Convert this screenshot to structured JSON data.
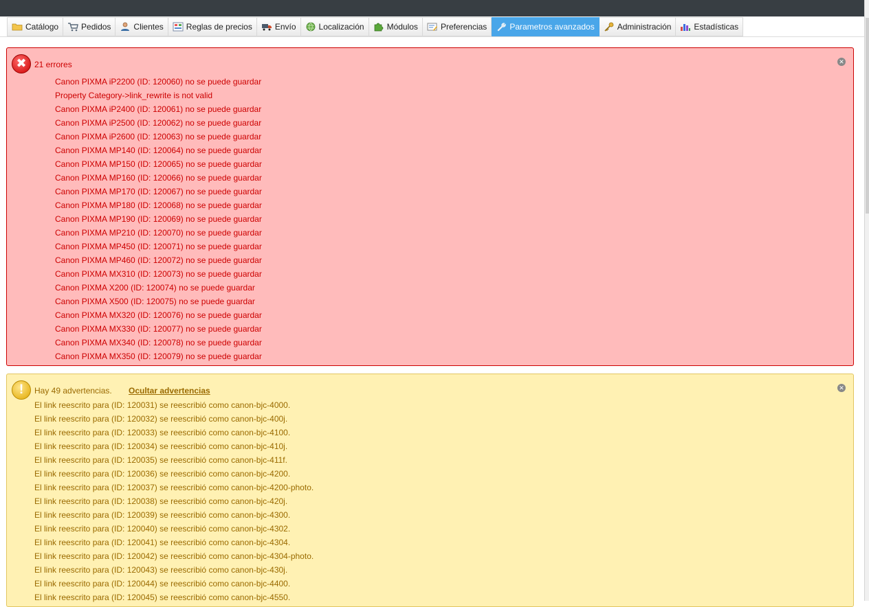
{
  "tabs": [
    {
      "label": "Catálogo",
      "icon": "folder-icon"
    },
    {
      "label": "Pedidos",
      "icon": "cart-icon"
    },
    {
      "label": "Clientes",
      "icon": "user-icon"
    },
    {
      "label": "Reglas de precios",
      "icon": "price-rules-icon"
    },
    {
      "label": "Envío",
      "icon": "truck-icon"
    },
    {
      "label": "Localización",
      "icon": "globe-icon"
    },
    {
      "label": "Módulos",
      "icon": "puzzle-icon"
    },
    {
      "label": "Preferencias",
      "icon": "preferences-icon"
    },
    {
      "label": "Parametros avanzados",
      "icon": "wrench-icon",
      "active": true
    },
    {
      "label": "Administración",
      "icon": "key-icon"
    },
    {
      "label": "Estadísticas",
      "icon": "bar-chart-icon"
    }
  ],
  "errors": {
    "title": "21 errores",
    "items": [
      "Canon PIXMA iP2200  (ID: 120060) no se puede guardar",
      "Property Category->link_rewrite is not valid",
      "Canon PIXMA iP2400 (ID: 120061) no se puede guardar",
      "Canon PIXMA iP2500 (ID: 120062) no se puede guardar",
      "Canon PIXMA iP2600 (ID: 120063) no se puede guardar",
      "Canon PIXMA MP140 (ID: 120064) no se puede guardar",
      "Canon PIXMA MP150 (ID: 120065) no se puede guardar",
      "Canon PIXMA MP160 (ID: 120066) no se puede guardar",
      "Canon PIXMA MP170 (ID: 120067) no se puede guardar",
      "Canon PIXMA MP180 (ID: 120068) no se puede guardar",
      "Canon PIXMA MP190 (ID: 120069) no se puede guardar",
      "Canon PIXMA MP210 (ID: 120070) no se puede guardar",
      "Canon PIXMA MP450 (ID: 120071) no se puede guardar",
      "Canon PIXMA MP460 (ID: 120072) no se puede guardar",
      "Canon PIXMA MX310 (ID: 120073) no se puede guardar",
      "Canon PIXMA X200 (ID: 120074) no se puede guardar",
      "Canon PIXMA X500 (ID: 120075) no se puede guardar",
      "Canon PIXMA MX320 (ID: 120076) no se puede guardar",
      "Canon PIXMA MX330 (ID: 120077) no se puede guardar",
      "Canon PIXMA MX340 (ID: 120078) no se puede guardar",
      "Canon PIXMA MX350 (ID: 120079) no se puede guardar"
    ]
  },
  "warnings": {
    "title": "Hay 49 advertencias.",
    "toggle_label": "Ocultar advertencias",
    "items": [
      "El link reescrito para (ID: 120031) se reescribió como canon-bjc-4000.",
      "El link reescrito para (ID: 120032) se reescribió como canon-bjc-400j.",
      "El link reescrito para (ID: 120033) se reescribió como canon-bjc-4100.",
      "El link reescrito para (ID: 120034) se reescribió como canon-bjc-410j.",
      "El link reescrito para (ID: 120035) se reescribió como canon-bjc-411f.",
      "El link reescrito para (ID: 120036) se reescribió como canon-bjc-4200.",
      "El link reescrito para (ID: 120037) se reescribió como canon-bjc-4200-photo.",
      "El link reescrito para (ID: 120038) se reescribió como canon-bjc-420j.",
      "El link reescrito para (ID: 120039) se reescribió como canon-bjc-4300.",
      "El link reescrito para (ID: 120040) se reescribió como canon-bjc-4302.",
      "El link reescrito para (ID: 120041) se reescribió como canon-bjc-4304.",
      "El link reescrito para (ID: 120042) se reescribió como canon-bjc-4304-photo.",
      "El link reescrito para (ID: 120043) se reescribió como canon-bjc-430j.",
      "El link reescrito para (ID: 120044) se reescribió como canon-bjc-4400.",
      "El link reescrito para (ID: 120045) se reescribió como canon-bjc-4550."
    ]
  },
  "colors": {
    "error_bg": "#ffbbbb",
    "error_text": "#cc0000",
    "warning_bg": "#fff1b3",
    "warning_text": "#9a6a00",
    "active_tab": "#49a6e9",
    "topbar": "#383e43"
  }
}
